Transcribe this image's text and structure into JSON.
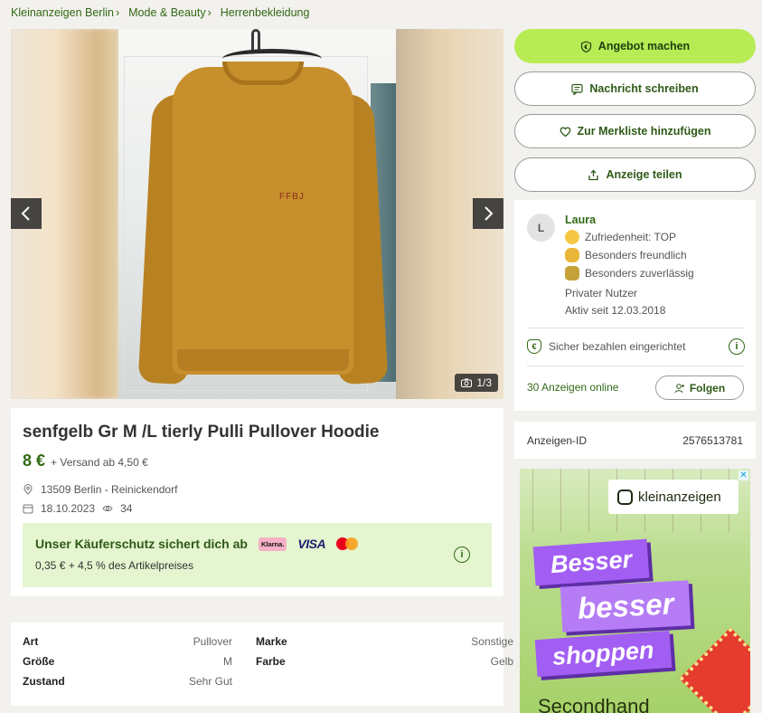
{
  "breadcrumb": [
    "Kleinanzeigen Berlin",
    "Mode & Beauty",
    "Herrenbekleidung"
  ],
  "gallery": {
    "counter": "1/3",
    "sweater_print": "FFBJ"
  },
  "listing": {
    "title": "senfgelb Gr M /L tierly Pulli Pullover Hoodie",
    "price": "8 €",
    "shipping": "+ Versand ab 4,50 €",
    "location": "13509 Berlin - Reinickendorf",
    "date": "18.10.2023",
    "views": "34"
  },
  "protection": {
    "heading": "Unser Käuferschutz sichert dich ab",
    "klarna": "Klarna.",
    "visa": "VISA",
    "fee": "0,35 € + 4,5 % des Artikelpreises"
  },
  "attributes": {
    "art_k": "Art",
    "art_v": "Pullover",
    "marke_k": "Marke",
    "marke_v": "Sonstige",
    "groesse_k": "Größe",
    "groesse_v": "M",
    "farbe_k": "Farbe",
    "farbe_v": "Gelb",
    "zustand_k": "Zustand",
    "zustand_v": "Sehr Gut"
  },
  "actions": {
    "offer": "Angebot machen",
    "message": "Nachricht schreiben",
    "watchlist": "Zur Merkliste hinzufügen",
    "share": "Anzeige teilen"
  },
  "seller": {
    "initial": "L",
    "name": "Laura",
    "satisfaction": "Zufriedenheit: TOP",
    "friendly": "Besonders freundlich",
    "reliable": "Besonders zuverlässig",
    "type": "Privater Nutzer",
    "active_since": "Aktiv seit 12.03.2018",
    "secure_pay": "Sicher bezahlen eingerichtet",
    "ads_online": "30 Anzeigen online",
    "follow": "Folgen"
  },
  "ad_id": {
    "label": "Anzeigen-ID",
    "value": "2576513781"
  },
  "advert": {
    "brand": "kleinanzeigen",
    "word1": "Besser",
    "word2": "besser",
    "word3": "shoppen",
    "sub": "Secondhand"
  },
  "colors": {
    "brand_green": "#326916",
    "cta_lime": "#b8ec55",
    "sweater": "#c8902c"
  }
}
